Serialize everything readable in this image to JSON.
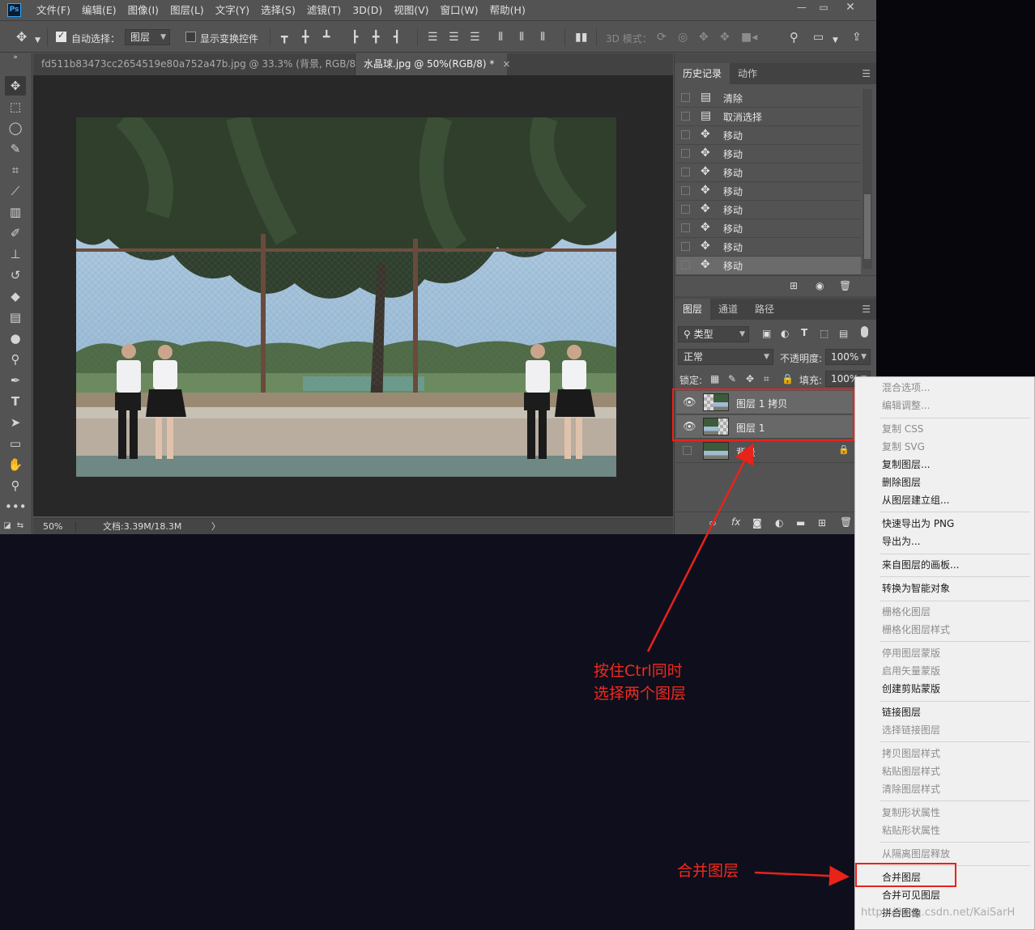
{
  "app": {
    "logo": "Ps",
    "menu": [
      "文件(F)",
      "编辑(E)",
      "图像(I)",
      "图层(L)",
      "文字(Y)",
      "选择(S)",
      "滤镜(T)",
      "3D(D)",
      "视图(V)",
      "窗口(W)",
      "帮助(H)"
    ],
    "window_controls": [
      "minimize-icon",
      "restore-icon",
      "close-icon"
    ]
  },
  "options_bar": {
    "auto_select_label": "自动选择：",
    "auto_select_checked": true,
    "auto_select_target": "图层",
    "show_transform_label": "显示变换控件",
    "show_transform_checked": false,
    "mode_3d_label": "3D 模式："
  },
  "tabs": [
    {
      "label": "fd511b83473cc2654519e80a752a47b.jpg @ 33.3% (背景, RGB/8) *",
      "active": false
    },
    {
      "label": "水晶球.jpg @ 50%(RGB/8) *",
      "active": true
    }
  ],
  "status": {
    "zoom": "50%",
    "doc_info": "文档:3.39M/18.3M",
    "arrow": "〉"
  },
  "history_panel": {
    "tabs": [
      "历史记录",
      "动作"
    ],
    "items": [
      {
        "label": "清除",
        "icon": "document-icon"
      },
      {
        "label": "取消选择",
        "icon": "document-icon"
      },
      {
        "label": "移动",
        "icon": "move-icon"
      },
      {
        "label": "移动",
        "icon": "move-icon"
      },
      {
        "label": "移动",
        "icon": "move-icon"
      },
      {
        "label": "移动",
        "icon": "move-icon"
      },
      {
        "label": "移动",
        "icon": "move-icon"
      },
      {
        "label": "移动",
        "icon": "move-icon"
      },
      {
        "label": "移动",
        "icon": "move-icon"
      },
      {
        "label": "移动",
        "icon": "move-icon"
      }
    ]
  },
  "layers_panel": {
    "tabs": [
      "图层",
      "通道",
      "路径"
    ],
    "filter_kind": "类型",
    "blend_mode": "正常",
    "opacity_label": "不透明度:",
    "opacity_value": "100%",
    "lock_label": "锁定:",
    "fill_label": "填充:",
    "fill_value": "100%",
    "layers": [
      {
        "name": "图层 1 拷贝",
        "visible": true,
        "selected": true,
        "locked": false
      },
      {
        "name": "图层 1",
        "visible": true,
        "selected": true,
        "locked": false
      },
      {
        "name": "背景",
        "visible": false,
        "selected": false,
        "locked": true
      }
    ]
  },
  "context_menu": {
    "items": [
      {
        "label": "混合选项...",
        "enabled": false
      },
      {
        "label": "编辑调整...",
        "enabled": false
      },
      {
        "label": "复制 CSS",
        "enabled": false
      },
      {
        "label": "复制 SVG",
        "enabled": false
      },
      {
        "label": "复制图层...",
        "enabled": true
      },
      {
        "label": "删除图层",
        "enabled": true
      },
      {
        "label": "从图层建立组...",
        "enabled": true
      },
      {
        "label": "快速导出为 PNG",
        "enabled": true
      },
      {
        "label": "导出为...",
        "enabled": true
      },
      {
        "label": "来自图层的画板...",
        "enabled": true
      },
      {
        "label": "转换为智能对象",
        "enabled": true
      },
      {
        "label": "栅格化图层",
        "enabled": false
      },
      {
        "label": "栅格化图层样式",
        "enabled": false
      },
      {
        "label": "停用图层蒙版",
        "enabled": false
      },
      {
        "label": "启用矢量蒙版",
        "enabled": false
      },
      {
        "label": "创建剪贴蒙版",
        "enabled": true
      },
      {
        "label": "链接图层",
        "enabled": true
      },
      {
        "label": "选择链接图层",
        "enabled": false
      },
      {
        "label": "拷贝图层样式",
        "enabled": false
      },
      {
        "label": "粘贴图层样式",
        "enabled": false
      },
      {
        "label": "清除图层样式",
        "enabled": false
      },
      {
        "label": "复制形状属性",
        "enabled": false
      },
      {
        "label": "粘贴形状属性",
        "enabled": false
      },
      {
        "label": "从隔离图层释放",
        "enabled": false
      },
      {
        "label": "合并图层",
        "enabled": true
      },
      {
        "label": "合并可见图层",
        "enabled": true
      },
      {
        "label": "拼合图像",
        "enabled": true
      }
    ]
  },
  "annotations": {
    "select_note_line1": "按住Ctrl同时",
    "select_note_line2": "选择两个图层",
    "merge_note": "合并图层",
    "color": "#e8231a"
  },
  "watermark": "https://blog.csdn.net/KaiSarH"
}
